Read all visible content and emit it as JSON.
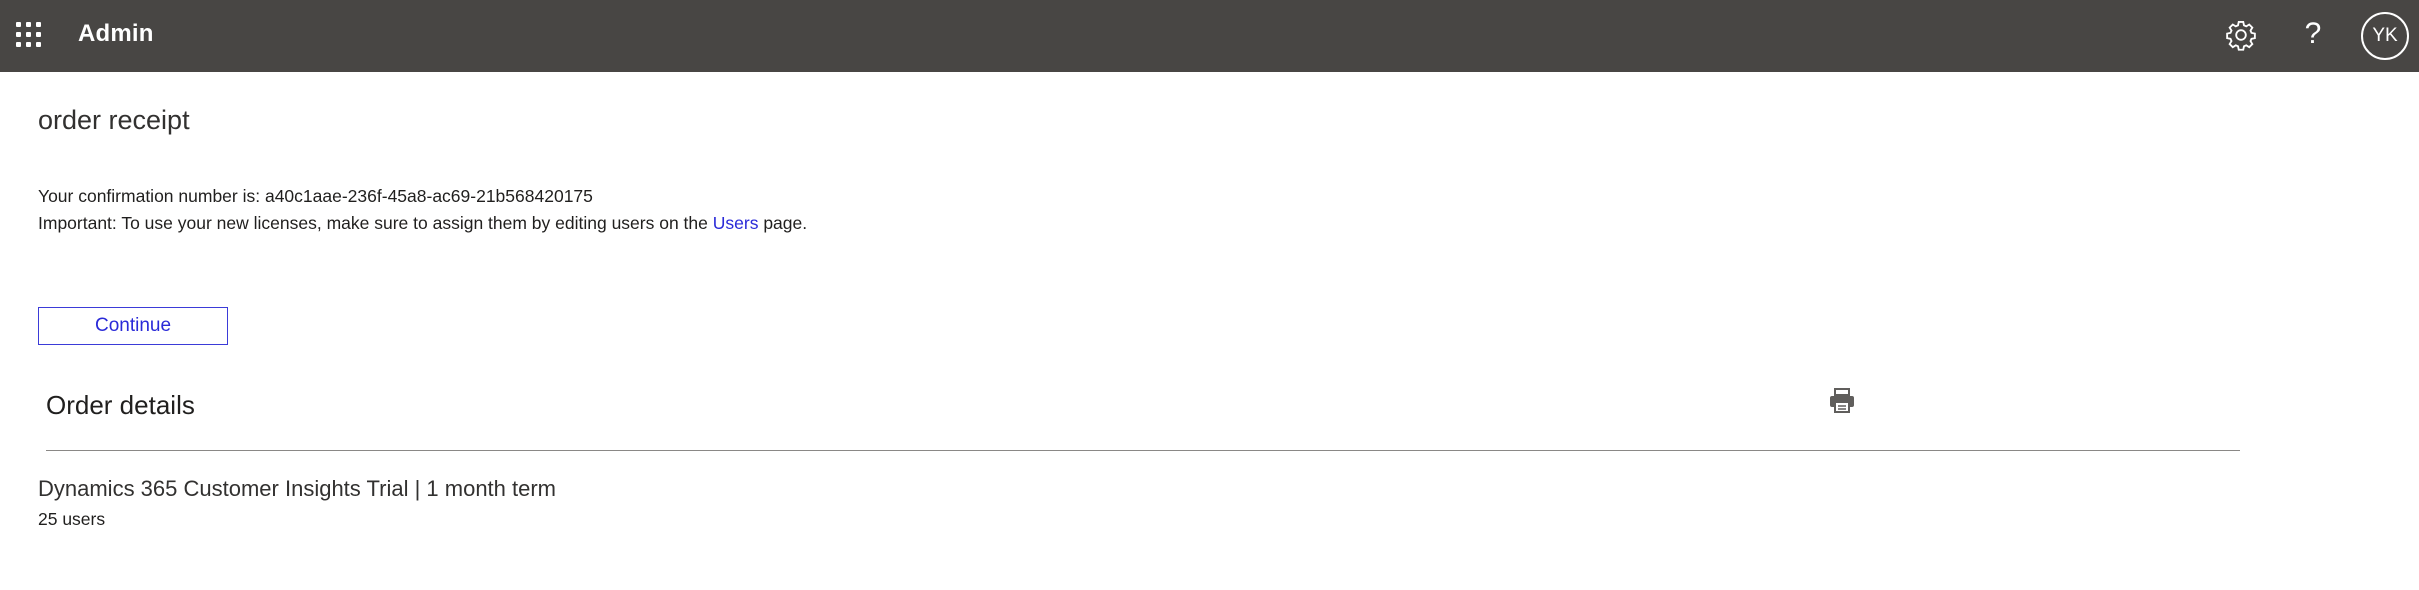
{
  "header": {
    "app_title": "Admin",
    "waffle_icon": "app-launcher-icon",
    "settings_icon": "gear-icon",
    "help_label": "?",
    "avatar_initials": "YK",
    "background_color": "#484644"
  },
  "main": {
    "page_title": "order receipt",
    "confirmation_prefix": "Your confirmation number is: ",
    "confirmation_number": "a40c1aae-236f-45a8-ac69-21b568420175",
    "important_prefix": "Important: To use your new licenses, make sure to assign them by editing users on the ",
    "users_link": "Users",
    "important_suffix": " page.",
    "continue_label": "Continue",
    "link_color": "#2a2ad8"
  },
  "order_details": {
    "title": "Order details",
    "print_icon": "printer-icon",
    "items": [
      {
        "name": "Dynamics 365 Customer Insights Trial | 1 month term",
        "quantity": "25 users"
      }
    ]
  }
}
